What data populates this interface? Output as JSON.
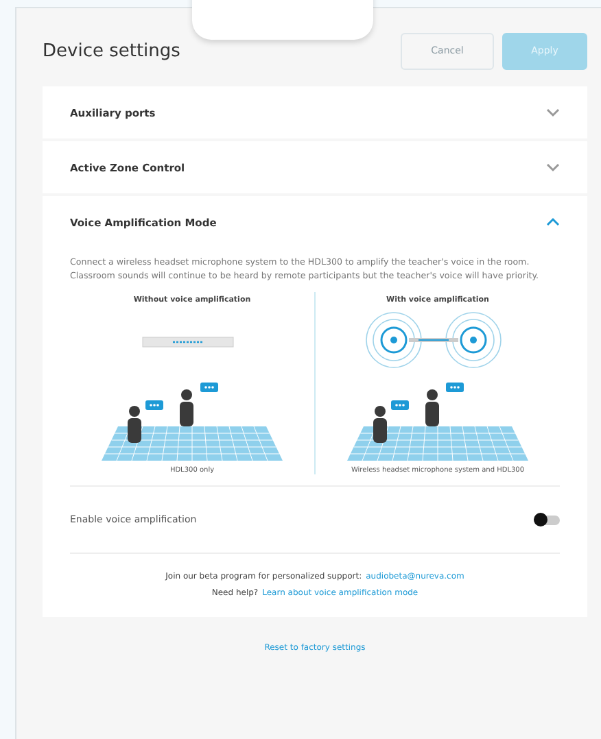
{
  "header": {
    "title": "Device settings",
    "buttons": [
      {
        "label": "Cancel",
        "kind": "secondary",
        "disabled": true
      },
      {
        "label": "Apply",
        "kind": "primary",
        "disabled": true
      }
    ]
  },
  "sections": [
    {
      "title": "Auxiliary ports",
      "expanded": false
    },
    {
      "title": "Active Zone Control",
      "expanded": false
    },
    {
      "title": "Voice Amplification Mode",
      "expanded": true,
      "description": "Connect a wireless headset microphone system to the HDL300 to amplify the teacher's voice in the room. Classroom sounds will continue to be heard by remote participants but the teacher's voice will have priority.",
      "illustrations": [
        {
          "title": "Without voice amplification",
          "caption": "HDL300 only",
          "kind": "without"
        },
        {
          "title": "With voice amplification",
          "caption": "Wireless headset microphone system and HDL300",
          "kind": "with"
        }
      ],
      "toggle": {
        "label": "Enable voice amplification",
        "on": false
      },
      "support": {
        "text": "Join our beta program for personalized support:",
        "link": "audiobeta@nureva.com"
      },
      "help": {
        "text": "Need help?",
        "link": "Learn about voice amplification mode"
      }
    }
  ],
  "footer_link": "Reset to factory settings"
}
